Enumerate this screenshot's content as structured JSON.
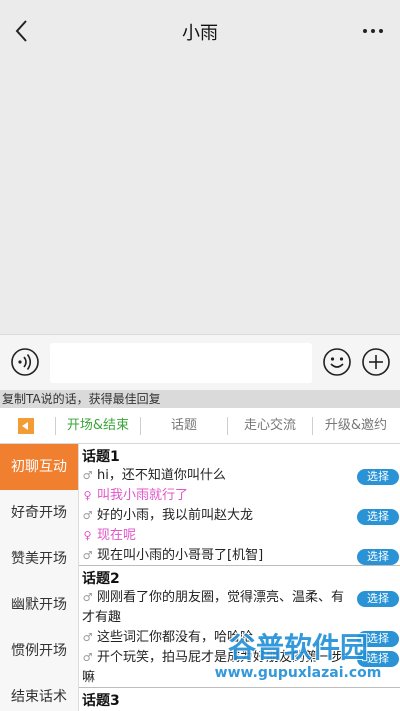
{
  "header": {
    "title": "小雨"
  },
  "icons": {
    "back": "chevron-left-icon",
    "more": "more-dots-icon",
    "voice": "voice-icon",
    "emoji": "smiley-icon",
    "plus": "plus-icon"
  },
  "input": {
    "value": "",
    "placeholder": ""
  },
  "hint": {
    "text": "复制TA说的话，获得最佳回复"
  },
  "tabs": [
    {
      "label": "开场&结束",
      "active": true
    },
    {
      "label": "话题"
    },
    {
      "label": "走心交流"
    },
    {
      "label": "升级&邀约"
    }
  ],
  "sidebar": [
    {
      "label": "初聊互动",
      "active": true
    },
    {
      "label": "好奇开场"
    },
    {
      "label": "赞美开场"
    },
    {
      "label": "幽默开场"
    },
    {
      "label": "惯例开场"
    },
    {
      "label": "结束话术"
    }
  ],
  "choose_label": "选择",
  "gender_symbols": {
    "male": "♂",
    "female": "♀"
  },
  "topics": [
    {
      "title": "话题1",
      "lines": [
        {
          "gender": "male",
          "text": "hi，还不知道你叫什么"
        },
        {
          "gender": "female",
          "text": "叫我小雨就行了"
        },
        {
          "gender": "male",
          "text": "好的小雨，我以前叫赵大龙"
        },
        {
          "gender": "female",
          "text": "现在呢"
        },
        {
          "gender": "male",
          "text": "现在叫小雨的小哥哥了[机智]"
        }
      ]
    },
    {
      "title": "话题2",
      "lines": [
        {
          "gender": "male",
          "text": "刚刚看了你的朋友圈，觉得漂亮、温柔、有才有趣"
        },
        {
          "gender": "male",
          "text": "这些词汇你都没有，哈哈哈"
        },
        {
          "gender": "male",
          "text": "开个玩笑，拍马屁才是成为好朋友的第一步嘛"
        }
      ]
    },
    {
      "title": "话题3",
      "lines": []
    }
  ],
  "watermark": {
    "brand": "谷普软件园",
    "url": "www.gupuxlazai.com"
  },
  "colors": {
    "active_tab": "#3aa63a",
    "active_side": "#f07f30",
    "choose_button": "#2a93d5",
    "female_text": "#e055c8"
  }
}
